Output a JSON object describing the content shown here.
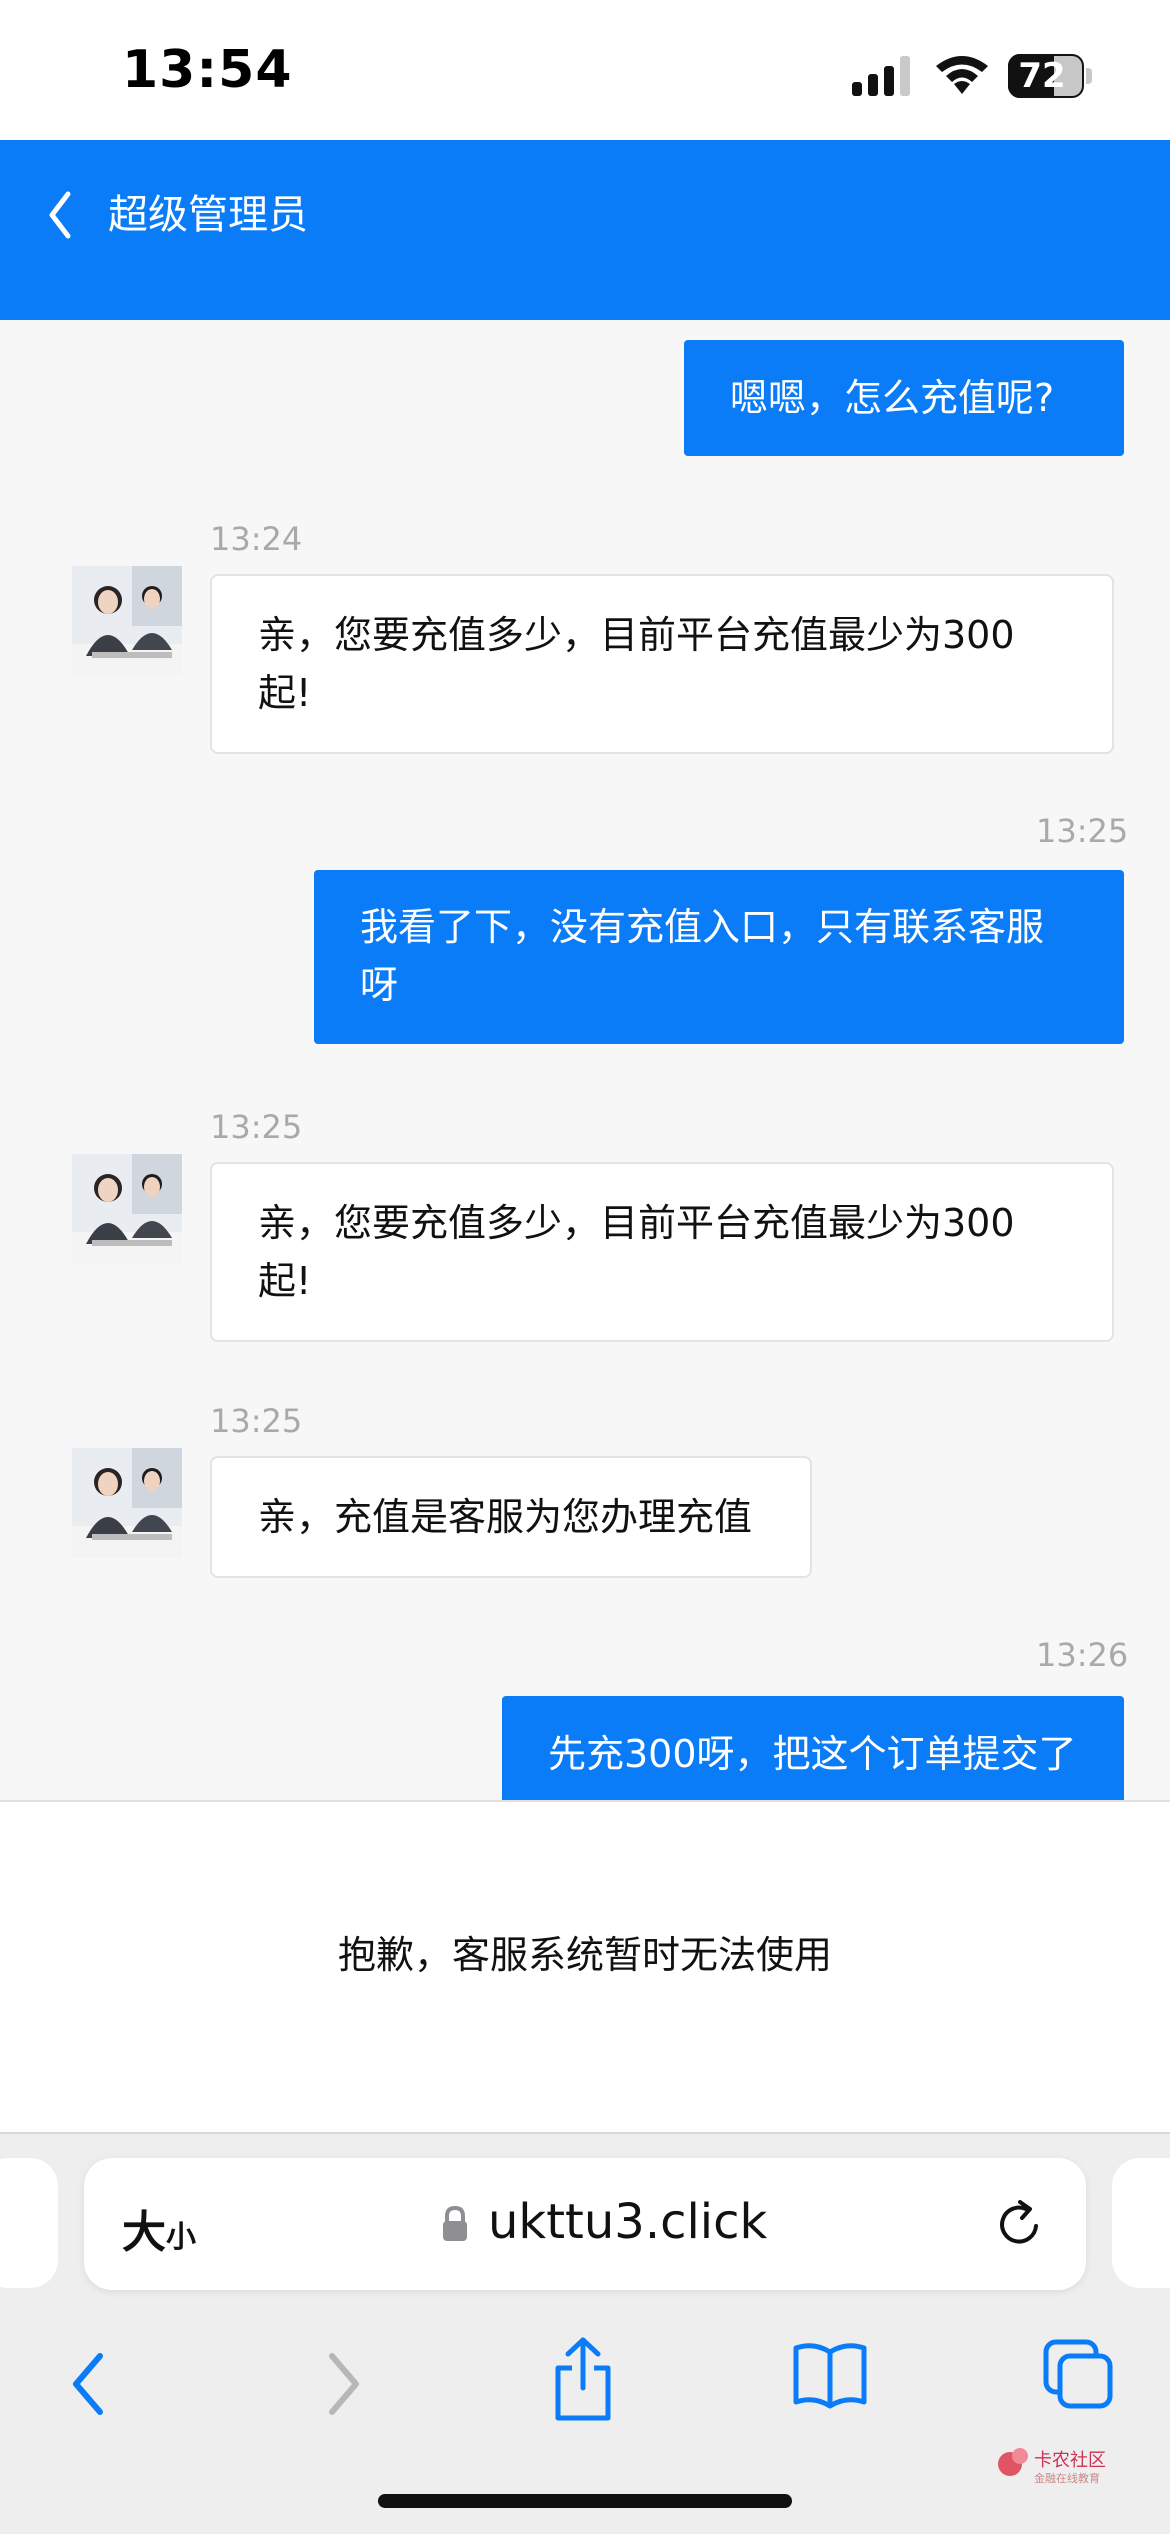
{
  "status_bar": {
    "time": "13:54",
    "battery": "72",
    "icons": [
      "signal-icon",
      "wifi-icon",
      "battery-icon"
    ]
  },
  "header": {
    "title": "超级管理员",
    "back_icon": "chevron-left-icon",
    "background": "#0a7cf7"
  },
  "messages": [
    {
      "side": "out",
      "text": "嗯嗯，怎么充值呢?"
    },
    {
      "side": "in",
      "time": "13:24",
      "line1": "亲，您要充值多少，目前平台充值最少为300",
      "line2": "起!"
    },
    {
      "side": "out",
      "time": "13:25",
      "line1": "我看了下，没有充值入口，只有联系客服",
      "line2": "呀"
    },
    {
      "side": "in",
      "time": "13:25",
      "line1": "亲，您要充值多少，目前平台充值最少为300",
      "line2": "起!"
    },
    {
      "side": "in",
      "time": "13:25",
      "text": "亲，充值是客服为您办理充值"
    },
    {
      "side": "out",
      "time": "13:26",
      "text": "先充300呀，把这个订单提交了"
    }
  ],
  "notice": {
    "text": "抱歉，客服系统暂时无法使用"
  },
  "browser": {
    "textsize_big": "大",
    "textsize_small": "小",
    "url": "ukttu3.click",
    "toolbar_icons": [
      "back-icon",
      "forward-icon",
      "share-icon",
      "bookmarks-icon",
      "tabs-icon"
    ]
  },
  "watermark": {
    "text": "卡农社区",
    "sub": "金融在线教育"
  },
  "colors": {
    "accent": "#0a7cf7",
    "chat_bg": "#f7f7f7",
    "timestamp": "#a9a9a9"
  }
}
